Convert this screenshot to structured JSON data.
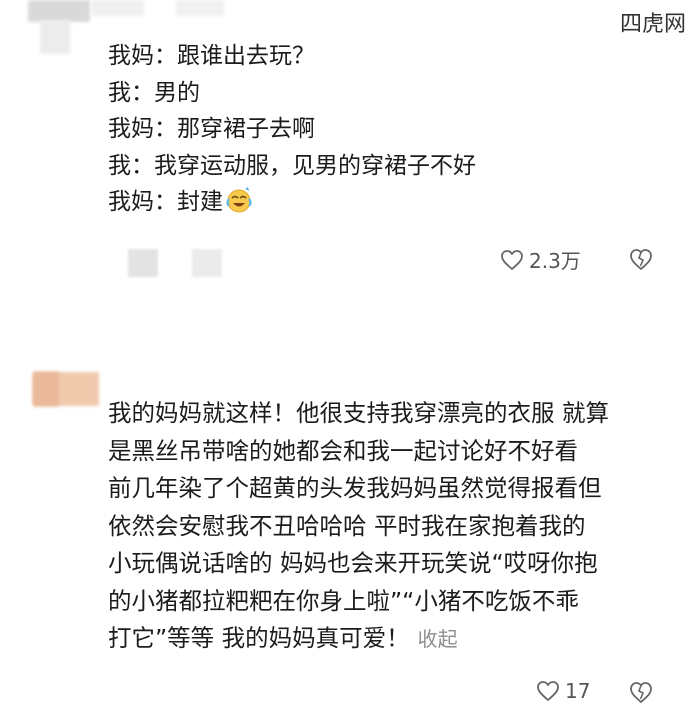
{
  "watermark": "四虎网",
  "comment1": {
    "lines": [
      "我妈：跟谁出去玩？",
      "我：男的",
      "我妈：那穿裙子去啊",
      "我：我穿运动服，见男的穿裙子不好",
      "我妈：封建"
    ],
    "emoji_icon": "laugh-cry-emoji-icon",
    "like_count": "2.3万"
  },
  "comment2": {
    "lines": [
      "我的妈妈就这样！他很支持我穿漂亮的衣服 就算",
      "是黑丝吊带啥的她都会和我一起讨论好不好看",
      "前几年染了个超黄的头发我妈妈虽然觉得报看但",
      "依然会安慰我不丑哈哈哈 平时我在家抱着我的",
      "小玩偶说话啥的 妈妈也会来开玩笑说“哎呀你抱",
      "的小猪都拉粑粑在你身上啦”“小猪不吃饭不乖",
      "打它”等等 我的妈妈真可爱！"
    ],
    "collapse_label": "收起",
    "like_count": "17"
  },
  "colors": {
    "text": "#1c1c1c",
    "secondary": "#8e8e8e",
    "avatar_blur": "#f0c9ad"
  }
}
